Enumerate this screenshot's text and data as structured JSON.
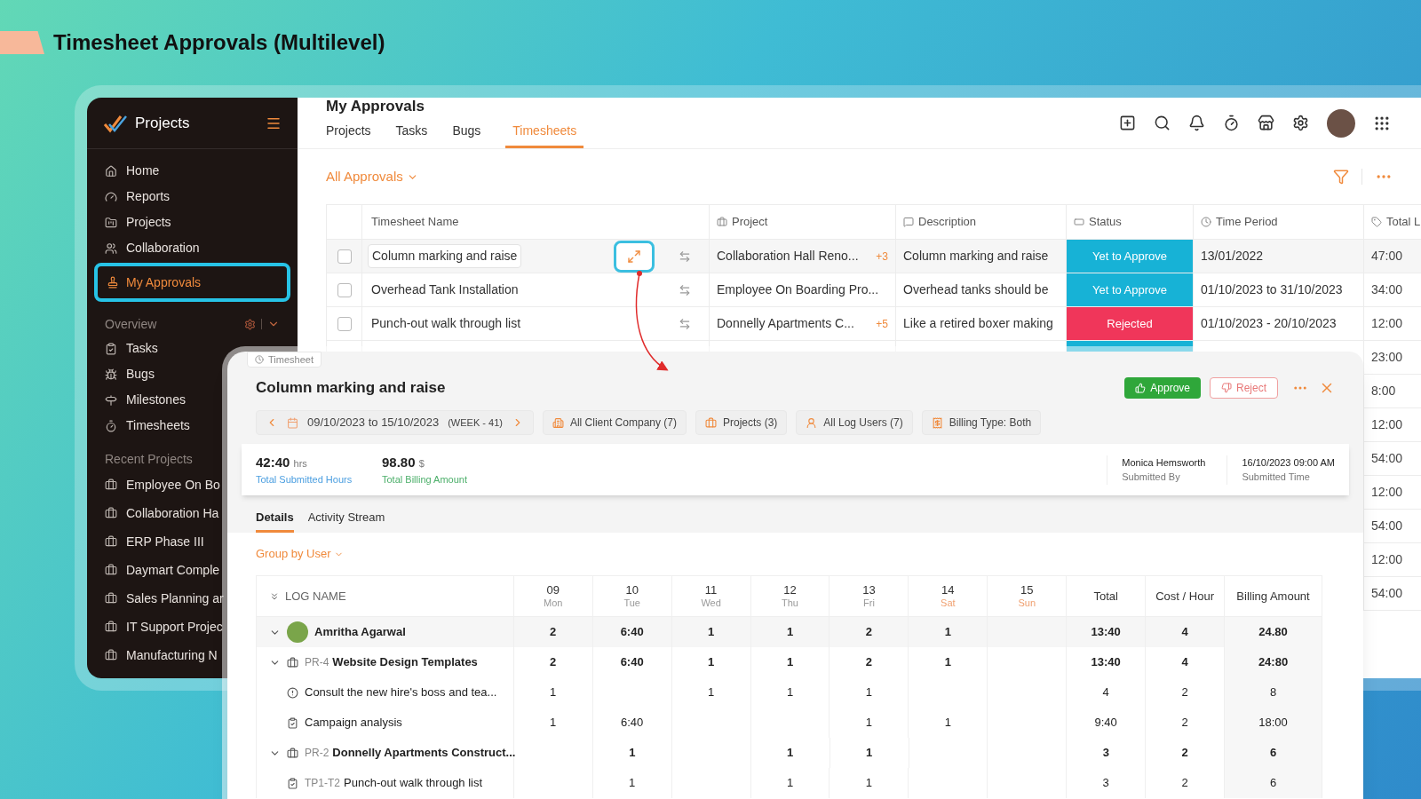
{
  "slide_title": "Timesheet Approvals (Multilevel)",
  "sidebar": {
    "app_name": "Projects",
    "items": [
      {
        "label": "Home",
        "selected": false
      },
      {
        "label": "Reports",
        "selected": false
      },
      {
        "label": "Projects",
        "selected": false
      },
      {
        "label": "Collaboration",
        "selected": false
      },
      {
        "label": "My Approvals",
        "selected": true
      }
    ],
    "overview": {
      "label": "Overview",
      "items": [
        {
          "label": "Tasks",
          "selected": false
        },
        {
          "label": "Bugs",
          "selected": false
        },
        {
          "label": "Milestones",
          "selected": false
        },
        {
          "label": "Timesheets",
          "selected": false
        }
      ]
    },
    "recent": {
      "label": "Recent Projects",
      "items": [
        "Employee On Bo",
        "Collaboration Ha",
        "ERP Phase III",
        "Daymart Comple",
        "Sales Planning ar",
        "IT Support Projec",
        "Manufacturing N"
      ]
    }
  },
  "header": {
    "title": "My Approvals",
    "tabs": [
      {
        "label": "Projects",
        "selected": false
      },
      {
        "label": "Tasks",
        "selected": false
      },
      {
        "label": "Bugs",
        "selected": false
      },
      {
        "label": "Timesheets",
        "selected": true
      }
    ]
  },
  "filter": {
    "label": "All Approvals"
  },
  "table": {
    "columns": [
      "Timesheet Name",
      "Project",
      "Description",
      "Status",
      "Time Period",
      "Total L"
    ],
    "rows": [
      {
        "selected": true,
        "checked": false,
        "name": "Column marking and raise",
        "project": "Collaboration Hall Reno...",
        "extra": "+3",
        "description": "Column marking and raise",
        "status": {
          "text": "Yet to Approve",
          "color": "#17b2d6"
        },
        "period": "13/01/2022",
        "total": "47:00"
      },
      {
        "selected": false,
        "checked": false,
        "name": "Overhead Tank Installation",
        "project": "Employee On Boarding Pro...",
        "description": "Overhead tanks should be",
        "status": {
          "text": "Yet to Approve",
          "color": "#17b2d6"
        },
        "period": "01/10/2023 to 31/10/2023",
        "total": "34:00"
      },
      {
        "selected": false,
        "checked": false,
        "name": "Punch-out walk through list",
        "project": "Donnelly Apartments C...",
        "extra": "+5",
        "description": "Like a retired boxer making",
        "status": {
          "text": "Rejected",
          "color": "#f0365a"
        },
        "period": "01/10/2023 - 20/10/2023",
        "total": "12:00"
      },
      {
        "status": {
          "color": "#17b2d6"
        },
        "total": "23:00"
      },
      {
        "total": "8:00"
      },
      {
        "total": "12:00"
      },
      {
        "total": "54:00"
      },
      {
        "total": "12:00"
      },
      {
        "total": "54:00"
      },
      {
        "total": "12:00"
      },
      {
        "total": "54:00"
      }
    ]
  },
  "panel": {
    "tag": "Timesheet",
    "title": "Column marking and raise",
    "approve": "Approve",
    "reject": "Reject",
    "date_range": "09/10/2023 to 15/10/2023",
    "week": "(WEEK - 41)",
    "chips": [
      "All Client Company (7)",
      "Projects (3)",
      "All Log Users (7)",
      "Billing Type: Both"
    ],
    "summary": {
      "hours": "42:40",
      "hours_unit": "hrs",
      "hours_label": "Total Submitted Hours",
      "amount": "98.80",
      "amount_unit": "$",
      "amount_label": "Total Billing Amount",
      "submitted_by": "Monica Hemsworth",
      "submitted_by_label": "Submitted By",
      "submitted_time": "16/10/2023 09:00 AM",
      "submitted_time_label": "Submitted Time"
    },
    "tabs": [
      {
        "label": "Details",
        "selected": true
      },
      {
        "label": "Activity Stream",
        "selected": false
      }
    ],
    "group_by": "Group by User",
    "grid": {
      "name_header": "LOG NAME",
      "days": [
        {
          "date": "09",
          "day": "Mon",
          "weekend": false
        },
        {
          "date": "10",
          "day": "Tue",
          "weekend": false
        },
        {
          "date": "11",
          "day": "Wed",
          "weekend": false
        },
        {
          "date": "12",
          "day": "Thu",
          "weekend": false
        },
        {
          "date": "13",
          "day": "Fri",
          "weekend": false
        },
        {
          "date": "14",
          "day": "Sat",
          "weekend": true
        },
        {
          "date": "15",
          "day": "Sun",
          "weekend": true
        }
      ],
      "totals_headers": [
        "Total",
        "Cost / Hour",
        "Billing Amount"
      ],
      "rows": [
        {
          "kind": "user",
          "name": "Amritha Agarwal",
          "expanded": true,
          "cells": [
            "2",
            "6:40",
            "1",
            "1",
            "2",
            "1",
            null
          ],
          "total": "13:40",
          "cost": "4",
          "billing": "24.80"
        },
        {
          "kind": "project",
          "code": "PR-4",
          "name": "Website Design Templates",
          "expanded": true,
          "cells": [
            "2",
            "6:40",
            "1",
            "1",
            "2",
            "1",
            null
          ],
          "total": "13:40",
          "cost": "4",
          "billing": "24:80"
        },
        {
          "kind": "issue",
          "name": "Consult the new hire's boss and tea...",
          "cells": [
            "1",
            null,
            "1",
            "1",
            "1",
            null,
            null
          ],
          "total": "4",
          "cost": "2",
          "billing": "8"
        },
        {
          "kind": "task",
          "name": "Campaign analysis",
          "cells": [
            "1",
            "6:40",
            null,
            null,
            "1",
            "1",
            null
          ],
          "total": "9:40",
          "cost": "2",
          "billing": "18:00"
        },
        {
          "kind": "project",
          "code": "PR-2",
          "name": "Donnelly Apartments Construct...",
          "expanded": true,
          "cells": [
            null,
            "1",
            null,
            "1",
            "1",
            null,
            null
          ],
          "total": "3",
          "cost": "2",
          "billing": "6"
        },
        {
          "kind": "task",
          "code": "TP1-T2",
          "name": "Punch-out walk through list",
          "cells": [
            null,
            "1",
            null,
            "1",
            "1",
            null,
            null
          ],
          "total": "3",
          "cost": "2",
          "billing": "6"
        }
      ]
    }
  }
}
